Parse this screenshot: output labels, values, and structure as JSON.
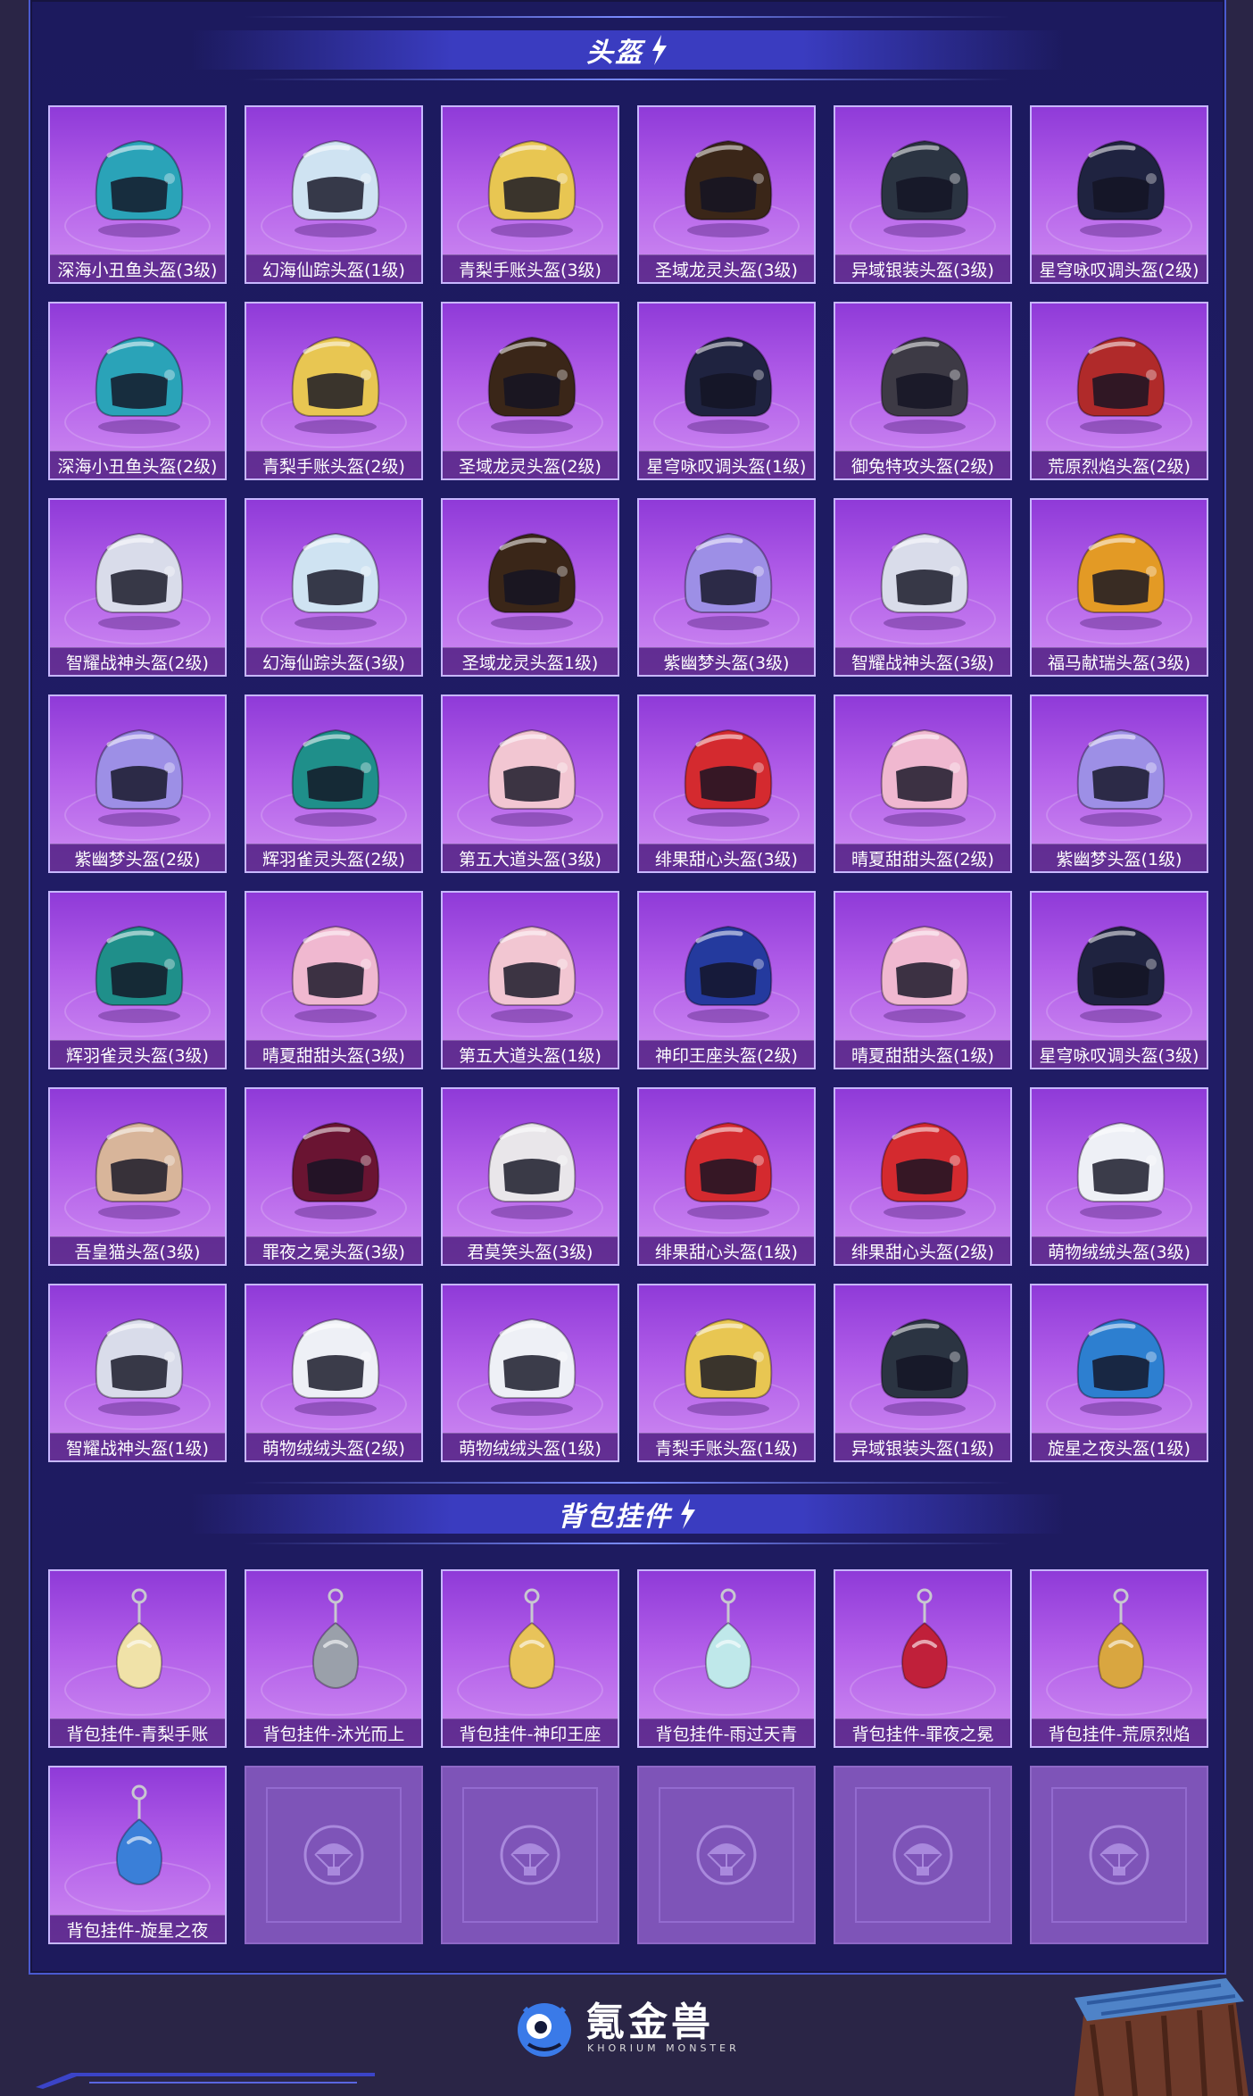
{
  "sections": {
    "helmets_title": "头盔",
    "pendants_title": "背包挂件"
  },
  "helmets": [
    {
      "label": "深海小丑鱼头盔(3级)",
      "color": "#2aa3b8"
    },
    {
      "label": "幻海仙踪头盔(1级)",
      "color": "#cfe3f2"
    },
    {
      "label": "青梨手账头盔(3级)",
      "color": "#e8c652"
    },
    {
      "label": "圣域龙灵头盔(3级)",
      "color": "#3a2618"
    },
    {
      "label": "异域银装头盔(3级)",
      "color": "#2b3442"
    },
    {
      "label": "星穹咏叹调头盔(2级)",
      "color": "#1f2340"
    },
    {
      "label": "深海小丑鱼头盔(2级)",
      "color": "#2aa3b8"
    },
    {
      "label": "青梨手账头盔(2级)",
      "color": "#e8c652"
    },
    {
      "label": "圣域龙灵头盔(2级)",
      "color": "#3a2618"
    },
    {
      "label": "星穹咏叹调头盔(1级)",
      "color": "#1f2340"
    },
    {
      "label": "御兔特攻头盔(2级)",
      "color": "#3d3a45"
    },
    {
      "label": "荒原烈焰头盔(2级)",
      "color": "#b02a2a"
    },
    {
      "label": "智耀战神头盔(2级)",
      "color": "#d9dcea"
    },
    {
      "label": "幻海仙踪头盔(3级)",
      "color": "#cfe3f2"
    },
    {
      "label": "圣域龙灵头盔1级)",
      "color": "#3a2618"
    },
    {
      "label": "紫幽梦头盔(3级)",
      "color": "#9d8fe6"
    },
    {
      "label": "智耀战神头盔(3级)",
      "color": "#d9dcea"
    },
    {
      "label": "福马献瑞头盔(3级)",
      "color": "#e39a25"
    },
    {
      "label": "紫幽梦头盔(2级)",
      "color": "#9d8fe6"
    },
    {
      "label": "辉羽雀灵头盔(2级)",
      "color": "#1f8f8a"
    },
    {
      "label": "第五大道头盔(3级)",
      "color": "#f2c6d2"
    },
    {
      "label": "绯果甜心头盔(3级)",
      "color": "#d42a2f"
    },
    {
      "label": "晴夏甜甜头盔(2级)",
      "color": "#f0b8d0"
    },
    {
      "label": "紫幽梦头盔(1级)",
      "color": "#9d8fe6"
    },
    {
      "label": "辉羽雀灵头盔(3级)",
      "color": "#1f8f8a"
    },
    {
      "label": "晴夏甜甜头盔(3级)",
      "color": "#f0b8d0"
    },
    {
      "label": "第五大道头盔(1级)",
      "color": "#f2c6d2"
    },
    {
      "label": "神印王座头盔(2级)",
      "color": "#243a9e"
    },
    {
      "label": "晴夏甜甜头盔(1级)",
      "color": "#f0b8d0"
    },
    {
      "label": "星穹咏叹调头盔(3级)",
      "color": "#1f2340"
    },
    {
      "label": "吾皇猫头盔(3级)",
      "color": "#d8b59a"
    },
    {
      "label": "罪夜之冕头盔(3级)",
      "color": "#6a1432"
    },
    {
      "label": "君莫笑头盔(3级)",
      "color": "#e9e6ea"
    },
    {
      "label": "绯果甜心头盔(1级)",
      "color": "#d42a2f"
    },
    {
      "label": "绯果甜心头盔(2级)",
      "color": "#d42a2f"
    },
    {
      "label": "萌物绒绒头盔(3级)",
      "color": "#eef0f6"
    },
    {
      "label": "智耀战神头盔(1级)",
      "color": "#d9dcea"
    },
    {
      "label": "萌物绒绒头盔(2级)",
      "color": "#eef0f6"
    },
    {
      "label": "萌物绒绒头盔(1级)",
      "color": "#eef0f6"
    },
    {
      "label": "青梨手账头盔(1级)",
      "color": "#e8c652"
    },
    {
      "label": "异域银装头盔(1级)",
      "color": "#2b3442"
    },
    {
      "label": "旋星之夜头盔(1级)",
      "color": "#2d7fd0"
    }
  ],
  "pendants": [
    {
      "label": "背包挂件-青梨手账",
      "color": "#f0e2a8"
    },
    {
      "label": "背包挂件-沐光而上",
      "color": "#9aa0aa"
    },
    {
      "label": "背包挂件-神印王座",
      "color": "#e8c35a"
    },
    {
      "label": "背包挂件-雨过天青",
      "color": "#bfe8ea"
    },
    {
      "label": "背包挂件-罪夜之冕",
      "color": "#c0203a"
    },
    {
      "label": "背包挂件-荒原烈焰",
      "color": "#d9a640"
    },
    {
      "label": "背包挂件-旋星之夜",
      "color": "#3a7fd8"
    }
  ],
  "empty_slots": 5,
  "footer": {
    "brand": "氪金兽",
    "brand_sub": "KHORIUM MONSTER"
  }
}
